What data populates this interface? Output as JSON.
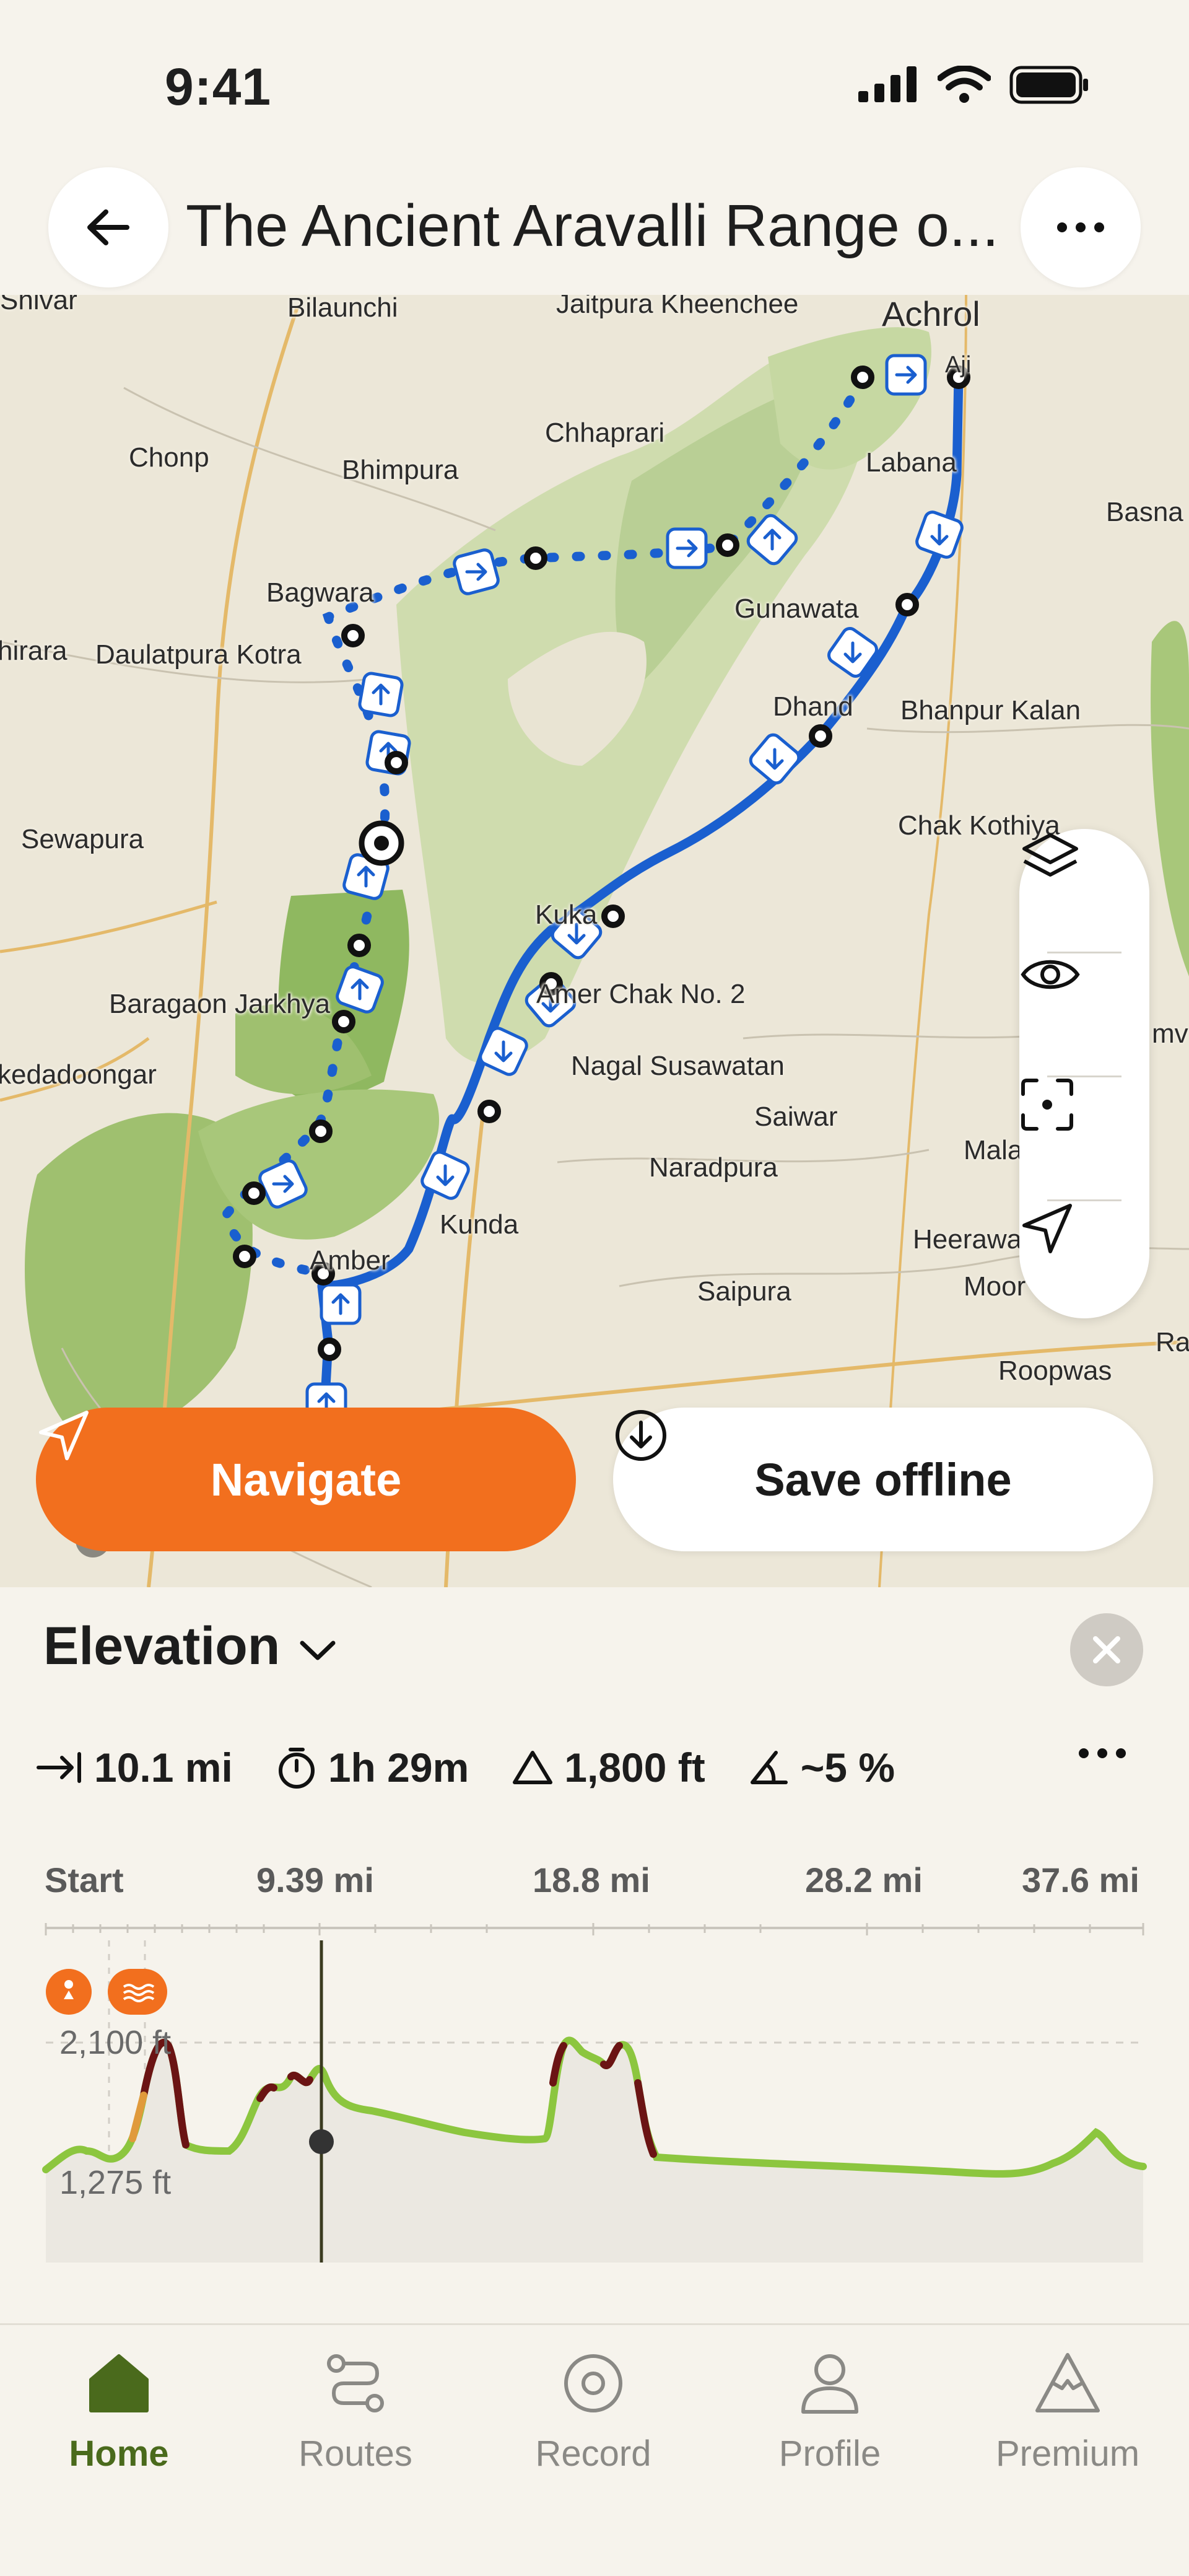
{
  "status_bar": {
    "time": "9:41"
  },
  "header": {
    "title": "The Ancient Aravalli Range o..."
  },
  "map": {
    "places": [
      "Bilaunchi",
      "Jaitpura Kheenchee",
      "Achrol",
      "Chonp",
      "Chhaprari",
      "Bhimpura",
      "Labana",
      "Basna",
      "Bagwara",
      "Gunawata",
      "hirara",
      "Daulatpura Kotra",
      "Dhand",
      "Bhanpur Kalan",
      "Sewapura",
      "Chak Kothiya",
      "Kuka",
      "Amer Chak No. 2",
      "Baragaon Jarkhya",
      "kedadoongar",
      "Nagal Susawatan",
      "Saiwar",
      "Naradpura",
      "Mala",
      "Kunda",
      "Heerawa",
      "Amber",
      "Saipura",
      "Moor",
      "Roopwas",
      "Ra",
      "mv",
      "Aji",
      "Shivar"
    ],
    "route_color": "#1a5fcf"
  },
  "actions": {
    "navigate_label": "Navigate",
    "offline_label": "Save offline"
  },
  "elevation": {
    "title": "Elevation",
    "stats": {
      "distance": "10.1 mi",
      "duration": "1h 29m",
      "ascent": "1,800 ft",
      "grade": "~5 %"
    },
    "ticks": [
      "Start",
      "9.39 mi",
      "18.8 mi",
      "28.2 mi",
      "37.6 mi"
    ],
    "y_labels": [
      "2,100 ft",
      "1,275 ft"
    ]
  },
  "tabs": [
    {
      "label": "Home",
      "active": true
    },
    {
      "label": "Routes",
      "active": false
    },
    {
      "label": "Record",
      "active": false
    },
    {
      "label": "Profile",
      "active": false
    },
    {
      "label": "Premium",
      "active": false
    }
  ],
  "colors": {
    "accent": "#f26f1e",
    "active_tab": "#4a6a1c",
    "profile_green": "#8cc63f",
    "profile_dark": "#6b1414"
  }
}
